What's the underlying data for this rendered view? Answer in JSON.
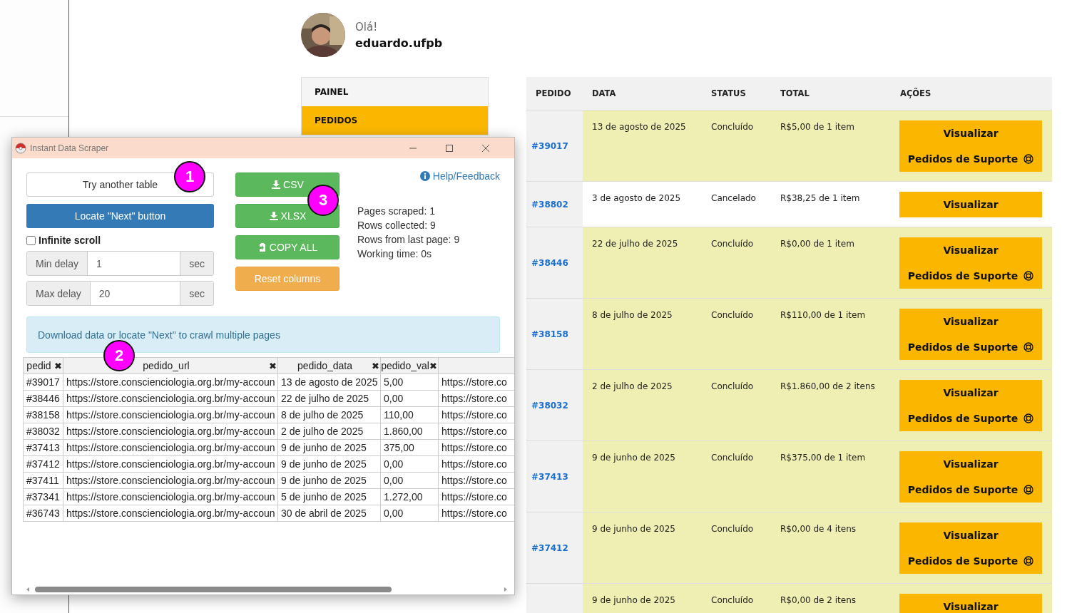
{
  "profile": {
    "greeting": "Olá!",
    "username": "eduardo.ufpb"
  },
  "nav": [
    {
      "label": "PAINEL",
      "selected": false
    },
    {
      "label": "PEDIDOS",
      "selected": true
    }
  ],
  "orders": {
    "columns": [
      "PEDIDO",
      "DATA",
      "STATUS",
      "TOTAL",
      "AÇÕES"
    ],
    "rows": [
      {
        "order": "#39017",
        "date": "13 de agosto de 2025",
        "status": "Concluído",
        "total": "R$5,00 de 1 item",
        "highlighted": true,
        "actions": [
          {
            "label": "Visualizar",
            "kind": "view"
          },
          {
            "label": "Pedidos de Suporte",
            "kind": "support"
          }
        ]
      },
      {
        "order": "#38802",
        "date": "3 de agosto de 2025",
        "status": "Cancelado",
        "total": "R$38,25 de 1 item",
        "highlighted": false,
        "actions": [
          {
            "label": "Visualizar",
            "kind": "view"
          }
        ]
      },
      {
        "order": "#38446",
        "date": "22 de julho de 2025",
        "status": "Concluído",
        "total": "R$0,00 de 1 item",
        "highlighted": true,
        "actions": [
          {
            "label": "Visualizar",
            "kind": "view"
          },
          {
            "label": "Pedidos de Suporte",
            "kind": "support"
          }
        ]
      },
      {
        "order": "#38158",
        "date": "8 de julho de 2025",
        "status": "Concluído",
        "total": "R$110,00 de 1 item",
        "highlighted": true,
        "actions": [
          {
            "label": "Visualizar",
            "kind": "view"
          },
          {
            "label": "Pedidos de Suporte",
            "kind": "support"
          }
        ]
      },
      {
        "order": "#38032",
        "date": "2 de julho de 2025",
        "status": "Concluído",
        "total": "R$1.860,00 de 2 itens",
        "highlighted": true,
        "actions": [
          {
            "label": "Visualizar",
            "kind": "view"
          },
          {
            "label": "Pedidos de Suporte",
            "kind": "support"
          }
        ]
      },
      {
        "order": "#37413",
        "date": "9 de junho de 2025",
        "status": "Concluído",
        "total": "R$375,00 de 1 item",
        "highlighted": true,
        "actions": [
          {
            "label": "Visualizar",
            "kind": "view"
          },
          {
            "label": "Pedidos de Suporte",
            "kind": "support"
          }
        ]
      },
      {
        "order": "#37412",
        "date": "9 de junho de 2025",
        "status": "Concluído",
        "total": "R$0,00 de 4 itens",
        "highlighted": true,
        "actions": [
          {
            "label": "Visualizar",
            "kind": "view"
          },
          {
            "label": "Pedidos de Suporte",
            "kind": "support"
          }
        ]
      },
      {
        "date": "9 de junho de 2025",
        "status": "Concluído",
        "total": "R$0,00 de 2 itens",
        "highlighted": true,
        "actions": [
          {
            "label": "Visualizar",
            "kind": "view"
          }
        ]
      }
    ]
  },
  "scraper": {
    "title": "Instant Data Scraper",
    "try_button": "Try another table",
    "locate_button": "Locate \"Next\" button",
    "infinite_scroll": {
      "label": "Infinite scroll",
      "checked": false
    },
    "delays": [
      {
        "label": "Min delay",
        "value": "1",
        "unit": "sec"
      },
      {
        "label": "Max delay",
        "value": "20",
        "unit": "sec"
      }
    ],
    "actions": [
      {
        "label": "CSV",
        "kind": "download"
      },
      {
        "label": "XLSX",
        "kind": "download"
      },
      {
        "label": "COPY ALL",
        "kind": "copy"
      },
      {
        "label": "Reset columns",
        "kind": "reset"
      }
    ],
    "help_link": "Help/Feedback",
    "stats": [
      "Pages scraped: 1",
      "Rows collected: 9",
      "Rows from last page: 9",
      "Working time: 0s"
    ],
    "alert": "Download data or locate \"Next\" to crawl multiple pages",
    "table": {
      "columns": [
        {
          "label": "pedid",
          "remove": "✖"
        },
        {
          "label": "pedido_url",
          "remove": "✖"
        },
        {
          "label": "pedido_data",
          "remove": "✖"
        },
        {
          "label": "pedido_val",
          "remove": "✖"
        },
        {}
      ],
      "rows": [
        [
          "#39017",
          "https://store.conscienciologia.org.br/my-accoun",
          "13 de agosto de 2025",
          "5,00",
          "https://store.co"
        ],
        [
          "#38446",
          "https://store.conscienciologia.org.br/my-accoun",
          "22 de julho de 2025",
          "0,00",
          "https://store.co"
        ],
        [
          "#38158",
          "https://store.conscienciologia.org.br/my-accoun",
          "8 de julho de 2025",
          "110,00",
          "https://store.co"
        ],
        [
          "#38032",
          "https://store.conscienciologia.org.br/my-accoun",
          "2 de julho de 2025",
          "1.860,00",
          "https://store.co"
        ],
        [
          "#37413",
          "https://store.conscienciologia.org.br/my-accoun",
          "9 de junho de 2025",
          "375,00",
          "https://store.co"
        ],
        [
          "#37412",
          "https://store.conscienciologia.org.br/my-accoun",
          "9 de junho de 2025",
          "0,00",
          "https://store.co"
        ],
        [
          "#37411",
          "https://store.conscienciologia.org.br/my-accoun",
          "9 de junho de 2025",
          "0,00",
          "https://store.co"
        ],
        [
          "#37341",
          "https://store.conscienciologia.org.br/my-accoun",
          "5 de junho de 2025",
          "1.272,00",
          "https://store.co"
        ],
        [
          "#36743",
          "https://store.conscienciologia.org.br/my-accoun",
          "30 de abril de 2025",
          "0,00",
          "https://store.co"
        ]
      ]
    },
    "markers": [
      {
        "label": "1"
      },
      {
        "label": "2"
      },
      {
        "label": "3"
      }
    ]
  }
}
